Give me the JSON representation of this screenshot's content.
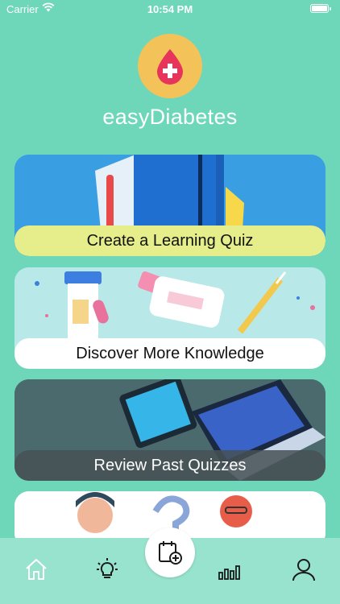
{
  "status_bar": {
    "carrier": "Carrier",
    "time": "10:54 PM"
  },
  "app": {
    "title": "easyDiabetes"
  },
  "cards": [
    {
      "label": "Create a Learning Quiz"
    },
    {
      "label": "Discover More Knowledge"
    },
    {
      "label": "Review Past Quizzes"
    }
  ],
  "tab_bar": {
    "items": [
      {
        "icon": "home-icon"
      },
      {
        "icon": "lightbulb-icon"
      },
      {
        "icon": "calendar-add-icon"
      },
      {
        "icon": "bar-chart-icon"
      },
      {
        "icon": "profile-icon"
      }
    ]
  },
  "colors": {
    "background": "#6fd7b9",
    "logo_circle": "#f3c359",
    "blood_drop": "#e8345a",
    "quiz_label_bg": "#e5ee8a",
    "tab_bar_bg": "#98e3ce"
  }
}
